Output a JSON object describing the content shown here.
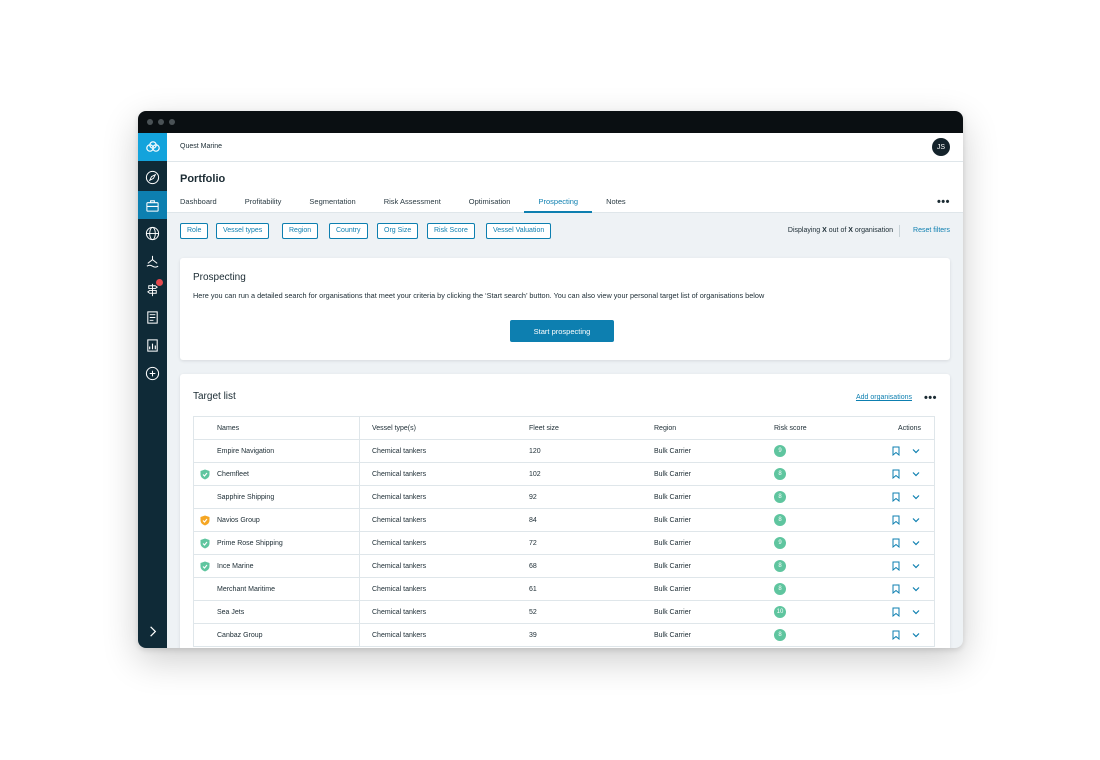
{
  "colors": {
    "accent": "#0d7fb0",
    "sidebar": "#0f2a37",
    "logo_bg": "#13a3dc",
    "score": "#5fc59f",
    "shield_green": "#5fc59f",
    "shield_orange": "#f5a623"
  },
  "topbar": {
    "org_name": "Quest Marine",
    "avatar_initials": "JS"
  },
  "sidebar": {
    "logo_icon": "rings-logo-icon",
    "items": [
      {
        "icon": "compass-icon",
        "active": false
      },
      {
        "icon": "briefcase-icon",
        "active": true
      },
      {
        "icon": "globe-icon",
        "active": false
      },
      {
        "icon": "ship-icon",
        "active": false
      },
      {
        "icon": "signpost-icon",
        "active": false,
        "badge": true
      },
      {
        "icon": "document-icon",
        "active": false
      },
      {
        "icon": "report-icon",
        "active": false
      },
      {
        "icon": "add-circle-icon",
        "active": false
      }
    ],
    "expand_icon": "chevron-right-icon"
  },
  "header": {
    "title": "Portfolio",
    "tabs": [
      {
        "label": "Dashboard"
      },
      {
        "label": "Profitability"
      },
      {
        "label": "Segmentation"
      },
      {
        "label": "Risk Assessment"
      },
      {
        "label": "Optimisation"
      },
      {
        "label": "Prospecting",
        "active": true
      },
      {
        "label": "Notes"
      }
    ]
  },
  "filters": {
    "chips": [
      "Role",
      "Vessel types",
      "Region",
      "Country",
      "Org Size",
      "Risk Score",
      "Vessel Valuation"
    ],
    "displaying_prefix": "Displaying ",
    "displaying_x1": "X",
    "displaying_mid": " out of ",
    "displaying_x2": "X",
    "displaying_suffix": " organisation",
    "reset_label": "Reset filters"
  },
  "prospecting": {
    "title": "Prospecting",
    "description": "Here you can run a detailed search for organisations that meet your criteria by clicking the ‘Start search’ button. You can also view your personal target list of organisations below",
    "button_label": "Start prospecting"
  },
  "target_list": {
    "title": "Target list",
    "add_label": "Add organisations",
    "columns": {
      "names": "Names",
      "vessel": "Vessel type(s)",
      "fleet": "Fleet size",
      "region": "Region",
      "risk": "Risk score",
      "actions": "Actions"
    },
    "rows": [
      {
        "name": "Empire Navigation",
        "vessel": "Chemical tankers",
        "fleet": "120",
        "region": "Bulk Carrier",
        "risk": "9",
        "shield": ""
      },
      {
        "name": "Chemfleet",
        "vessel": "Chemical tankers",
        "fleet": "102",
        "region": "Bulk Carrier",
        "risk": "8",
        "shield": "green"
      },
      {
        "name": "Sapphire Shipping",
        "vessel": "Chemical tankers",
        "fleet": "92",
        "region": "Bulk Carrier",
        "risk": "8",
        "shield": ""
      },
      {
        "name": "Navios Group",
        "vessel": "Chemical tankers",
        "fleet": "84",
        "region": "Bulk Carrier",
        "risk": "8",
        "shield": "orange"
      },
      {
        "name": "Prime Rose Shipping",
        "vessel": "Chemical tankers",
        "fleet": "72",
        "region": "Bulk Carrier",
        "risk": "9",
        "shield": "green"
      },
      {
        "name": "Ince Marine",
        "vessel": "Chemical tankers",
        "fleet": "68",
        "region": "Bulk Carrier",
        "risk": "8",
        "shield": "green"
      },
      {
        "name": "Merchant Maritime",
        "vessel": "Chemical tankers",
        "fleet": "61",
        "region": "Bulk Carrier",
        "risk": "8",
        "shield": ""
      },
      {
        "name": "Sea Jets",
        "vessel": "Chemical tankers",
        "fleet": "52",
        "region": "Bulk Carrier",
        "risk": "10",
        "shield": ""
      },
      {
        "name": "Canbaz Group",
        "vessel": "Chemical tankers",
        "fleet": "39",
        "region": "Bulk Carrier",
        "risk": "8",
        "shield": ""
      }
    ]
  }
}
